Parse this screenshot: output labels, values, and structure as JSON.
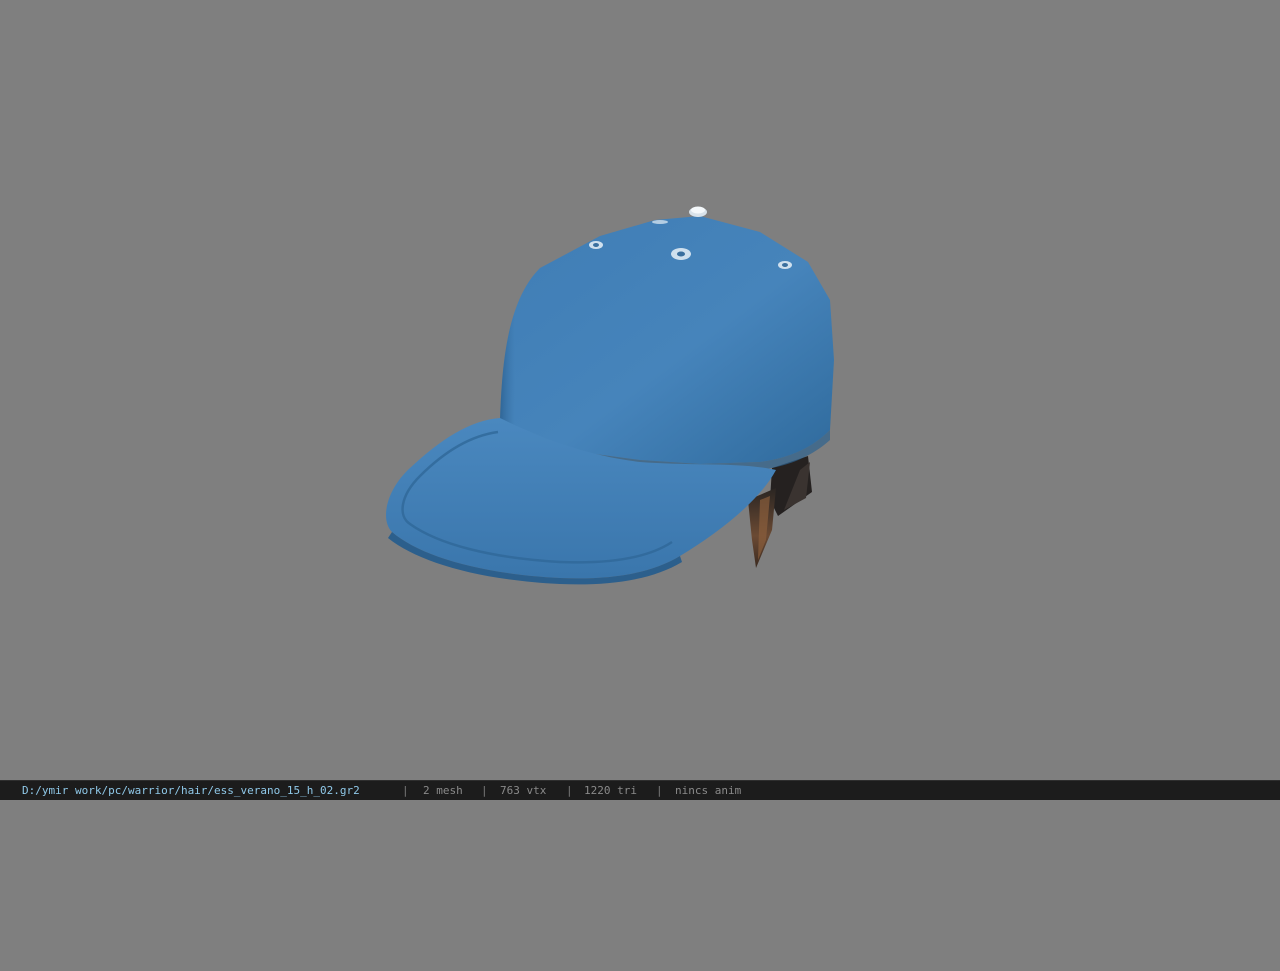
{
  "status_bar": {
    "file_path": "D:/ymir work/pc/warrior/hair/ess_verano_15_h_02.gr2",
    "separator": "|",
    "mesh_count": "2 mesh",
    "vertex_count": "763 vtx",
    "triangle_count": "1220 tri",
    "animation": "nincs anim"
  },
  "viewport": {
    "background_color": "#7f7f7f",
    "model": "baseball-cap-with-hair",
    "model_color": "#3f7db3"
  }
}
